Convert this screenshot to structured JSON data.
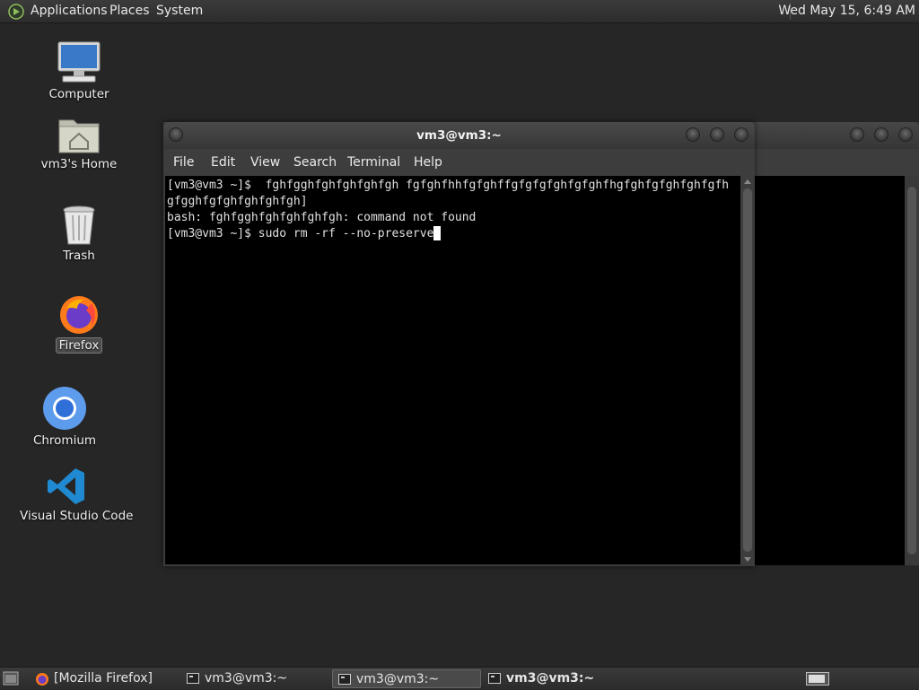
{
  "top_panel": {
    "menu": [
      "Applications",
      "Places",
      "System"
    ],
    "clock": "Wed May 15,  6:49 AM"
  },
  "desktop_icons": [
    {
      "label": "Computer",
      "icon": "computer-icon"
    },
    {
      "label": "vm3's Home",
      "icon": "home-folder-icon"
    },
    {
      "label": "Trash",
      "icon": "trash-icon"
    },
    {
      "label": "Firefox",
      "icon": "firefox-icon",
      "selected": true
    },
    {
      "label": "Chromium",
      "icon": "chromium-icon"
    },
    {
      "label": "Visual Studio Code",
      "icon": "vscode-icon"
    }
  ],
  "terminal": {
    "title": "vm3@vm3:~",
    "menu": [
      "File",
      "Edit",
      "View",
      "Search",
      "Terminal",
      "Help"
    ],
    "lines": [
      "[vm3@vm3 ~]$  fghfgghfghfghfghfgh fgfghfhhfgfghffgfgfgfghfgfghfhgfghfgfghfghfgfh",
      "gfgghfgfghfghfghfgh]",
      "bash: fghfgghfghfghfghfgh: command not found",
      "[vm3@vm3 ~]$ sudo rm -rf --no-preserve"
    ]
  },
  "taskbar": {
    "items": [
      {
        "label": "[Mozilla Firefox]",
        "icon": "firefox-icon"
      },
      {
        "label": "vm3@vm3:~",
        "icon": "terminal-icon"
      },
      {
        "label": "vm3@vm3:~",
        "icon": "terminal-icon",
        "active": true
      },
      {
        "label": "vm3@vm3:~",
        "icon": "terminal-icon",
        "bold": true
      }
    ]
  },
  "colors": {
    "desktop_bg": "#262626",
    "panel_bg": "#333333",
    "terminal_bg": "#000000",
    "terminal_fg": "#e0e0e0"
  }
}
